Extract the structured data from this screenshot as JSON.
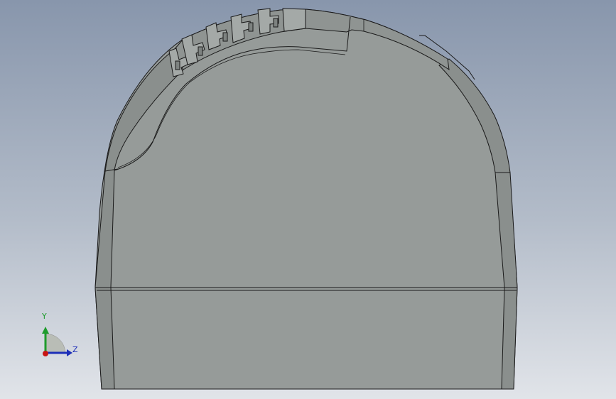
{
  "viewport": {
    "background_top": "#8896ac",
    "background_bottom": "#e1e4e9"
  },
  "model": {
    "face_color": "#969b99",
    "edge_color": "#1a1a1a",
    "shade_color": "#7d8280"
  },
  "triad": {
    "y_label": "Y",
    "z_label": "Z",
    "y_color": "#1e9b2c",
    "z_color": "#1d2fb8",
    "x_color": "#c81414",
    "shade": "#b9bdb6"
  }
}
